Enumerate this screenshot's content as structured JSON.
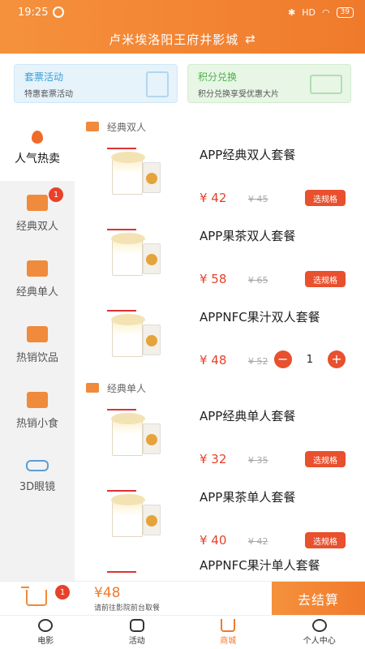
{
  "status_bar": {
    "time": "19:25",
    "network": "HD",
    "battery": "39"
  },
  "header": {
    "cinema_name": "卢米埃洛阳王府井影城",
    "swap_icon": "swap-icon"
  },
  "promos": [
    {
      "title": "套票活动",
      "subtitle": "特惠套票活动",
      "icon": "drink-cup-icon"
    },
    {
      "title": "积分兑换",
      "subtitle": "积分兑换享受优惠大片",
      "icon": "vip-ticket-icon"
    }
  ],
  "sidebar": {
    "items": [
      {
        "label": "人气热卖",
        "icon": "flame-icon",
        "active": true,
        "badge": ""
      },
      {
        "label": "经典双人",
        "icon": "popcorn-icon",
        "active": false,
        "badge": "1"
      },
      {
        "label": "经典单人",
        "icon": "popcorn-icon",
        "active": false,
        "badge": ""
      },
      {
        "label": "热销饮品",
        "icon": "drink-icon",
        "active": false,
        "badge": ""
      },
      {
        "label": "热销小食",
        "icon": "snack-icon",
        "active": false,
        "badge": ""
      },
      {
        "label": "3D眼镜",
        "icon": "glasses-icon",
        "active": false,
        "badge": ""
      }
    ]
  },
  "sections": [
    {
      "title": "经典双人",
      "products": [
        {
          "name": "APP经典双人套餐",
          "price": "¥ 42",
          "old_price": "¥ 45",
          "action": "选规格"
        },
        {
          "name": "APP果茶双人套餐",
          "price": "¥ 58",
          "old_price": "¥ 65",
          "action": "选规格"
        },
        {
          "name": "APPNFC果汁双人套餐",
          "price": "¥ 48",
          "old_price": "¥ 52",
          "quantity": "1",
          "minus": "−",
          "plus": "+"
        }
      ]
    },
    {
      "title": "经典单人",
      "products": [
        {
          "name": "APP经典单人套餐",
          "price": "¥ 32",
          "old_price": "¥ 35",
          "action": "选规格"
        },
        {
          "name": "APP果茶单人套餐",
          "price": "¥ 40",
          "old_price": "¥ 42",
          "action": "选规格"
        },
        {
          "name": "APPNFC果汁单人套餐"
        }
      ]
    }
  ],
  "cart": {
    "badge": "1",
    "total": "¥48",
    "note": "请前往影院前台取餐",
    "checkout": "去结算"
  },
  "tabbar": [
    {
      "label": "电影",
      "icon": "film-reel-icon",
      "active": false
    },
    {
      "label": "活动",
      "icon": "gift-icon",
      "active": false
    },
    {
      "label": "商城",
      "icon": "cart-icon",
      "active": true
    },
    {
      "label": "个人中心",
      "icon": "user-icon",
      "active": false
    }
  ],
  "colors": {
    "brand": "#f07a2c",
    "price": "#e8412a",
    "button": "#e8502e"
  }
}
